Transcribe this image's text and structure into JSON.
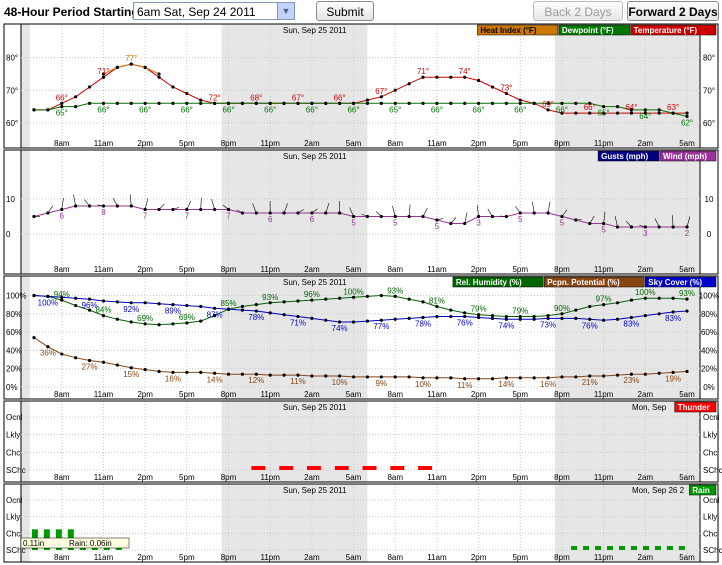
{
  "header": {
    "period_label": "48-Hour Period Starting:",
    "period_value": "6am Sat, Sep 24 2011",
    "submit_label": "Submit",
    "back_label": "Back 2 Days",
    "forward_label": "Forward 2 Days"
  },
  "colors": {
    "temperature": "#cc0000",
    "heat_index": "#cc7700",
    "dewpoint": "#007700",
    "wind": "#993399",
    "gusts": "#000080",
    "humidity": "#006600",
    "precip_potential": "#884411",
    "sky_cover": "#0000cc",
    "thunder": "#ff0000",
    "rain": "#009900",
    "night_shade": "#e6e6e6"
  },
  "hour_labels": [
    "8am",
    "11am",
    "2pm",
    "5pm",
    "8pm",
    "11pm",
    "2am",
    "5am",
    "8am",
    "11am",
    "2pm",
    "5pm",
    "8pm",
    "11pm",
    "2am",
    "5am"
  ],
  "chart_data": [
    {
      "type": "line",
      "name": "temperature-panel",
      "date_label": "Sun, Sep 25 2011",
      "legend": [
        "Heat Index (°F)",
        "Dewpoint (°F)",
        "Temperature (°F)"
      ],
      "y_ticks": [
        "80°",
        "70°",
        "60°"
      ],
      "ylim": [
        56,
        86
      ],
      "series": [
        {
          "name": "Temperature (°F)",
          "color_key": "temperature",
          "values": [
            64,
            64,
            66,
            68,
            71,
            74,
            77,
            78,
            77,
            74,
            71,
            69,
            67,
            66,
            66,
            66,
            66,
            66,
            66,
            66,
            66,
            66,
            66,
            66,
            67,
            68,
            70,
            72,
            74,
            74,
            74,
            74,
            73,
            71,
            69,
            67,
            66,
            64,
            63,
            63,
            63,
            63,
            63,
            63,
            63,
            63,
            63,
            63
          ]
        },
        {
          "name": "Heat Index (°F)",
          "color_key": "heat_index",
          "values": [
            null,
            null,
            null,
            null,
            null,
            75,
            77,
            78,
            77,
            75,
            null,
            null,
            null,
            null,
            null,
            null,
            null,
            null,
            null,
            null,
            null,
            null,
            null,
            null,
            null,
            null,
            null,
            null,
            null,
            null,
            null,
            null,
            null,
            null,
            null,
            null,
            null,
            null,
            null,
            null,
            null,
            null,
            null,
            null,
            null,
            null,
            null,
            null
          ]
        },
        {
          "name": "Dewpoint (°F)",
          "color_key": "dewpoint",
          "values": [
            64,
            64,
            65,
            65,
            66,
            66,
            66,
            66,
            66,
            66,
            66,
            66,
            66,
            66,
            66,
            66,
            66,
            66,
            66,
            66,
            66,
            66,
            66,
            66,
            66,
            66,
            66,
            66,
            66,
            66,
            66,
            66,
            66,
            66,
            66,
            66,
            66,
            66,
            66,
            66,
            66,
            65,
            65,
            64,
            64,
            64,
            63,
            62
          ]
        }
      ],
      "point_labels": [
        {
          "series": 0,
          "i": 2,
          "text": "66°"
        },
        {
          "series": 0,
          "i": 5,
          "text": "71°"
        },
        {
          "series": 1,
          "i": 7,
          "text": "77°"
        },
        {
          "series": 1,
          "i": 10,
          "text": "77°"
        },
        {
          "series": 0,
          "i": 13,
          "text": "72°"
        },
        {
          "series": 0,
          "i": 16,
          "text": "68°"
        },
        {
          "series": 0,
          "i": 19,
          "text": "67°"
        },
        {
          "series": 0,
          "i": 22,
          "text": "66°"
        },
        {
          "series": 0,
          "i": 25,
          "text": "67°"
        },
        {
          "series": 0,
          "i": 28,
          "text": "71°"
        },
        {
          "series": 0,
          "i": 31,
          "text": "74°"
        },
        {
          "series": 0,
          "i": 34,
          "text": "73°"
        },
        {
          "series": 0,
          "i": 37,
          "text": "69°"
        },
        {
          "series": 0,
          "i": 40,
          "text": "66°"
        },
        {
          "series": 0,
          "i": 43,
          "text": "64°"
        },
        {
          "series": 0,
          "i": 46,
          "text": "63°"
        },
        {
          "series": 2,
          "i": 2,
          "text": "65°"
        },
        {
          "series": 2,
          "i": 5,
          "text": "66°"
        },
        {
          "series": 2,
          "i": 8,
          "text": "66°"
        },
        {
          "series": 2,
          "i": 11,
          "text": "66°"
        },
        {
          "series": 2,
          "i": 14,
          "text": "66°"
        },
        {
          "series": 2,
          "i": 17,
          "text": "66°"
        },
        {
          "series": 2,
          "i": 20,
          "text": "66°"
        },
        {
          "series": 2,
          "i": 23,
          "text": "66°"
        },
        {
          "series": 2,
          "i": 26,
          "text": "65°"
        },
        {
          "series": 2,
          "i": 29,
          "text": "66°"
        },
        {
          "series": 2,
          "i": 32,
          "text": "66°"
        },
        {
          "series": 2,
          "i": 35,
          "text": "66°"
        },
        {
          "series": 2,
          "i": 38,
          "text": "66°"
        },
        {
          "series": 2,
          "i": 41,
          "text": "65°"
        },
        {
          "series": 2,
          "i": 44,
          "text": "64°"
        },
        {
          "series": 2,
          "i": 47,
          "text": "62°"
        }
      ]
    },
    {
      "type": "line",
      "name": "wind-panel",
      "date_label": "Sun, Sep 25 2011",
      "legend": [
        "Gusts (mph)",
        "Wind (mph)"
      ],
      "y_ticks": [
        "10",
        "0"
      ],
      "ylim": [
        -8,
        20
      ],
      "series": [
        {
          "name": "Wind (mph)",
          "color_key": "wind",
          "values": [
            5,
            6,
            7,
            8,
            8,
            8,
            8,
            8,
            7,
            7,
            7,
            7,
            7,
            7,
            7,
            6,
            6,
            6,
            6,
            6,
            6,
            6,
            6,
            5,
            5,
            5,
            5,
            5,
            5,
            4,
            3,
            3,
            5,
            5,
            5,
            6,
            6,
            6,
            5,
            4,
            3,
            3,
            2,
            2,
            2,
            2,
            2,
            2
          ]
        }
      ],
      "point_labels": [
        {
          "series": 0,
          "i": 2,
          "text": "6"
        },
        {
          "series": 0,
          "i": 5,
          "text": "8"
        },
        {
          "series": 0,
          "i": 8,
          "text": "7"
        },
        {
          "series": 0,
          "i": 11,
          "text": "7"
        },
        {
          "series": 0,
          "i": 14,
          "text": "7"
        },
        {
          "series": 0,
          "i": 17,
          "text": "6"
        },
        {
          "series": 0,
          "i": 20,
          "text": "6"
        },
        {
          "series": 0,
          "i": 23,
          "text": "5"
        },
        {
          "series": 0,
          "i": 26,
          "text": "5"
        },
        {
          "series": 0,
          "i": 29,
          "text": "5"
        },
        {
          "series": 0,
          "i": 32,
          "text": "3"
        },
        {
          "series": 0,
          "i": 35,
          "text": "5"
        },
        {
          "series": 0,
          "i": 38,
          "text": "5"
        },
        {
          "series": 0,
          "i": 41,
          "text": "5"
        },
        {
          "series": 0,
          "i": 44,
          "text": "3"
        },
        {
          "series": 0,
          "i": 47,
          "text": "2"
        }
      ]
    },
    {
      "type": "line",
      "name": "humidity-panel",
      "date_label": "Sun, Sep 25 2011",
      "legend": [
        "Rel. Humidity (%)",
        "Pcpn. Potential (%)",
        "Sky Cover (%)"
      ],
      "y_ticks": [
        "100%",
        "80%",
        "60%",
        "40%",
        "20%",
        "0%"
      ],
      "ylim": [
        0,
        106
      ],
      "series": [
        {
          "name": "Rel. Humidity (%)",
          "color_key": "humidity",
          "values": [
            100,
            99,
            95,
            89,
            84,
            78,
            74,
            71,
            69,
            68,
            69,
            70,
            72,
            78,
            85,
            88,
            90,
            92,
            93,
            94,
            95,
            96,
            97,
            98,
            99,
            100,
            99,
            96,
            93,
            88,
            84,
            81,
            79,
            78,
            77,
            77,
            77,
            78,
            80,
            84,
            88,
            90,
            92,
            95,
            97,
            97,
            97,
            96
          ]
        },
        {
          "name": "Pcpn. Potential (%)",
          "color_key": "precip_potential",
          "values": [
            54,
            44,
            36,
            32,
            29,
            27,
            24,
            21,
            19,
            17,
            16,
            16,
            16,
            15,
            14,
            14,
            14,
            13,
            13,
            13,
            12,
            12,
            12,
            11,
            11,
            11,
            11,
            11,
            10,
            10,
            10,
            9,
            9,
            9,
            10,
            10,
            10,
            10,
            11,
            11,
            12,
            12,
            13,
            14,
            14,
            15,
            16,
            17
          ]
        },
        {
          "name": "Sky Cover (%)",
          "color_key": "sky_cover",
          "values": [
            100,
            99,
            98,
            97,
            96,
            94,
            93,
            92,
            92,
            91,
            90,
            89,
            88,
            86,
            85,
            84,
            83,
            81,
            79,
            77,
            75,
            73,
            71,
            71,
            72,
            73,
            74,
            75,
            76,
            77,
            77,
            77,
            76,
            75,
            74,
            74,
            74,
            75,
            75,
            75,
            74,
            73,
            74,
            76,
            78,
            80,
            82,
            83
          ]
        }
      ],
      "point_labels": [
        {
          "series": 0,
          "i": 2,
          "text": "94%"
        },
        {
          "series": 0,
          "i": 5,
          "text": "84%"
        },
        {
          "series": 0,
          "i": 8,
          "text": "69%"
        },
        {
          "series": 0,
          "i": 11,
          "text": "69%"
        },
        {
          "series": 0,
          "i": 14,
          "text": "85%"
        },
        {
          "series": 0,
          "i": 17,
          "text": "93%"
        },
        {
          "series": 0,
          "i": 20,
          "text": "96%"
        },
        {
          "series": 0,
          "i": 23,
          "text": "100%"
        },
        {
          "series": 0,
          "i": 26,
          "text": "93%"
        },
        {
          "series": 0,
          "i": 29,
          "text": "81%"
        },
        {
          "series": 0,
          "i": 32,
          "text": "79%"
        },
        {
          "series": 0,
          "i": 35,
          "text": "79%"
        },
        {
          "series": 0,
          "i": 38,
          "text": "90%"
        },
        {
          "series": 0,
          "i": 41,
          "text": "97%"
        },
        {
          "series": 0,
          "i": 44,
          "text": "100%"
        },
        {
          "series": 0,
          "i": 47,
          "text": "93%"
        },
        {
          "series": 2,
          "i": 1,
          "text": "100%"
        },
        {
          "series": 2,
          "i": 4,
          "text": "96%"
        },
        {
          "series": 2,
          "i": 7,
          "text": "92%"
        },
        {
          "series": 2,
          "i": 10,
          "text": "89%"
        },
        {
          "series": 2,
          "i": 13,
          "text": "87%"
        },
        {
          "series": 2,
          "i": 16,
          "text": "78%"
        },
        {
          "series": 2,
          "i": 19,
          "text": "71%"
        },
        {
          "series": 2,
          "i": 22,
          "text": "74%"
        },
        {
          "series": 2,
          "i": 25,
          "text": "77%"
        },
        {
          "series": 2,
          "i": 28,
          "text": "78%"
        },
        {
          "series": 2,
          "i": 31,
          "text": "76%"
        },
        {
          "series": 2,
          "i": 34,
          "text": "74%"
        },
        {
          "series": 2,
          "i": 37,
          "text": "73%"
        },
        {
          "series": 2,
          "i": 40,
          "text": "76%"
        },
        {
          "series": 2,
          "i": 43,
          "text": "83%"
        },
        {
          "series": 2,
          "i": 46,
          "text": "83%"
        },
        {
          "series": 1,
          "i": 1,
          "text": "36%"
        },
        {
          "series": 1,
          "i": 4,
          "text": "27%"
        },
        {
          "series": 1,
          "i": 7,
          "text": "15%"
        },
        {
          "series": 1,
          "i": 10,
          "text": "16%"
        },
        {
          "series": 1,
          "i": 13,
          "text": "14%"
        },
        {
          "series": 1,
          "i": 16,
          "text": "12%"
        },
        {
          "series": 1,
          "i": 19,
          "text": "11%"
        },
        {
          "series": 1,
          "i": 22,
          "text": "10%"
        },
        {
          "series": 1,
          "i": 25,
          "text": "9%"
        },
        {
          "series": 1,
          "i": 28,
          "text": "10%"
        },
        {
          "series": 1,
          "i": 31,
          "text": "11%"
        },
        {
          "series": 1,
          "i": 34,
          "text": "14%"
        },
        {
          "series": 1,
          "i": 37,
          "text": "16%"
        },
        {
          "series": 1,
          "i": 40,
          "text": "21%"
        },
        {
          "series": 1,
          "i": 43,
          "text": "23%"
        },
        {
          "series": 1,
          "i": 46,
          "text": "19%"
        }
      ]
    },
    {
      "type": "bar",
      "name": "thunder-panel",
      "date_label": "Sun, Sep 25 2011",
      "date_label_right": "Mon, Sep",
      "legend": [
        "Thunder"
      ],
      "y_ticks": [
        "Ocnl",
        "Lkly",
        "Chc",
        "SChc"
      ],
      "levels": [
        0,
        0,
        0,
        0,
        0,
        0,
        0,
        0,
        0,
        0,
        0,
        0,
        0,
        0,
        0,
        0,
        1,
        1,
        1,
        1,
        1,
        1,
        1,
        1,
        1,
        1,
        1,
        1,
        1,
        1,
        0,
        0,
        0,
        0,
        0,
        0,
        0,
        0,
        0,
        0,
        0,
        0,
        0,
        0,
        0,
        0,
        0,
        0
      ]
    },
    {
      "type": "bar",
      "name": "rain-panel",
      "date_label": "Sun, Sep 25 2011",
      "date_label_right": "Mon, Sep 26 2",
      "legend": [
        "Rain"
      ],
      "y_ticks": [
        "Ocnl",
        "Lkly",
        "Chc",
        "SChc"
      ],
      "levels": [
        2,
        2,
        2,
        2,
        2,
        2,
        2,
        1,
        1,
        1,
        1,
        1,
        1,
        1,
        1,
        0,
        0,
        0,
        0,
        0,
        0,
        0,
        0,
        0,
        0,
        0,
        0,
        0,
        0,
        0,
        0,
        0,
        0,
        0,
        0,
        0,
        0,
        0,
        0,
        0,
        0,
        0,
        0,
        0,
        0,
        0,
        0,
        0,
        0,
        0,
        0,
        0,
        0,
        0,
        0,
        0,
        0,
        0,
        0,
        0,
        0,
        0,
        0,
        0,
        0,
        0,
        0,
        0,
        0,
        0,
        0,
        0,
        0,
        0,
        0,
        0,
        0,
        0,
        0,
        0,
        0,
        0,
        0,
        0,
        0,
        0,
        0,
        0,
        0,
        1,
        1,
        1,
        1,
        1,
        1,
        1,
        1,
        1,
        1,
        1,
        1,
        1,
        1,
        1,
        1,
        1,
        1,
        1,
        1,
        1
      ],
      "tooltip": [
        "0.11in",
        "Rain: 0.06in"
      ]
    }
  ]
}
